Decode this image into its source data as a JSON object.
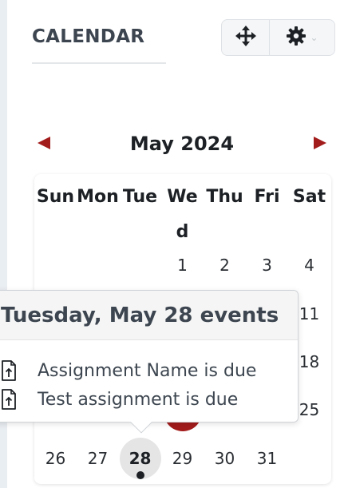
{
  "block": {
    "title": "CALENDAR",
    "move_icon": "move-arrows-icon",
    "settings_icon": "gear-icon"
  },
  "calendar": {
    "month_label": "May 2024",
    "prev_icon": "triangle-left-icon",
    "next_icon": "triangle-right-icon",
    "weekdays": [
      "Sun",
      "Mon",
      "Tue",
      "Wed",
      "Thu",
      "Fri",
      "Sat"
    ],
    "days": {
      "d1": "1",
      "d2": "2",
      "d3": "3",
      "d4": "4",
      "d11": "11",
      "d18": "18",
      "d25": "25",
      "d26": "26",
      "d27": "27",
      "d28": "28",
      "d29": "29",
      "d30": "30",
      "d31": "31"
    },
    "today": "28",
    "accent_color": "#a31c1c"
  },
  "popover": {
    "title": "Tuesday, May 28 events",
    "events": [
      {
        "label": "Assignment Name is due",
        "icon": "assignment-file-icon"
      },
      {
        "label": "Test assignment is due",
        "icon": "assignment-file-icon"
      }
    ]
  }
}
